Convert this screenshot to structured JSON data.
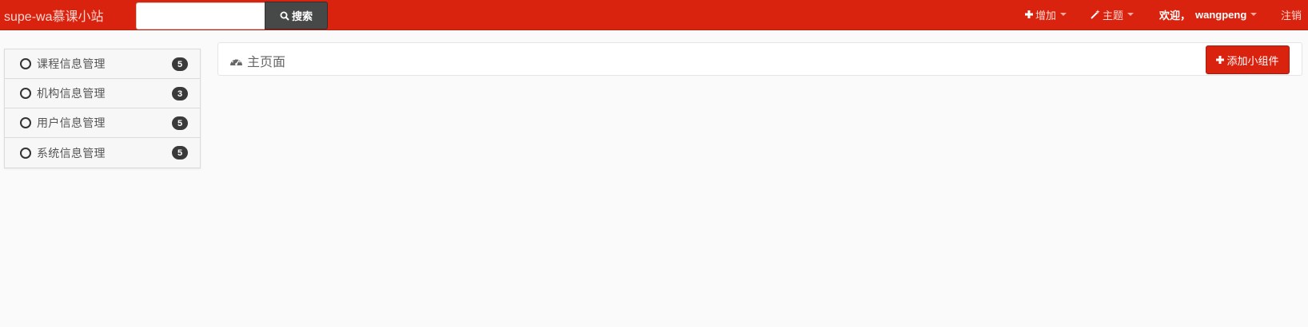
{
  "navbar": {
    "brand": "supe-wa慕课小站",
    "search": {
      "value": "",
      "placeholder": "",
      "button_label": "搜索"
    },
    "add_menu": {
      "label": "增加",
      "icon": "plus-icon"
    },
    "theme_menu": {
      "label": "主题",
      "icon": "magic-wand-icon"
    },
    "user_menu": {
      "greeting": "欢迎，",
      "username": "wangpeng"
    },
    "logout_label": "注销",
    "colors": {
      "primary": "#d9230f",
      "search_button": "#474949"
    }
  },
  "sidebar": {
    "items": [
      {
        "label": "课程信息管理",
        "badge": "5",
        "icon": "circle-icon"
      },
      {
        "label": "机构信息管理",
        "badge": "3",
        "icon": "circle-icon"
      },
      {
        "label": "用户信息管理",
        "badge": "5",
        "icon": "circle-icon"
      },
      {
        "label": "系统信息管理",
        "badge": "5",
        "icon": "circle-icon"
      }
    ]
  },
  "main": {
    "title": "主页面",
    "title_icon": "dashboard-icon",
    "add_widget_label": "添加小组件",
    "add_widget_icon": "plus-icon"
  }
}
